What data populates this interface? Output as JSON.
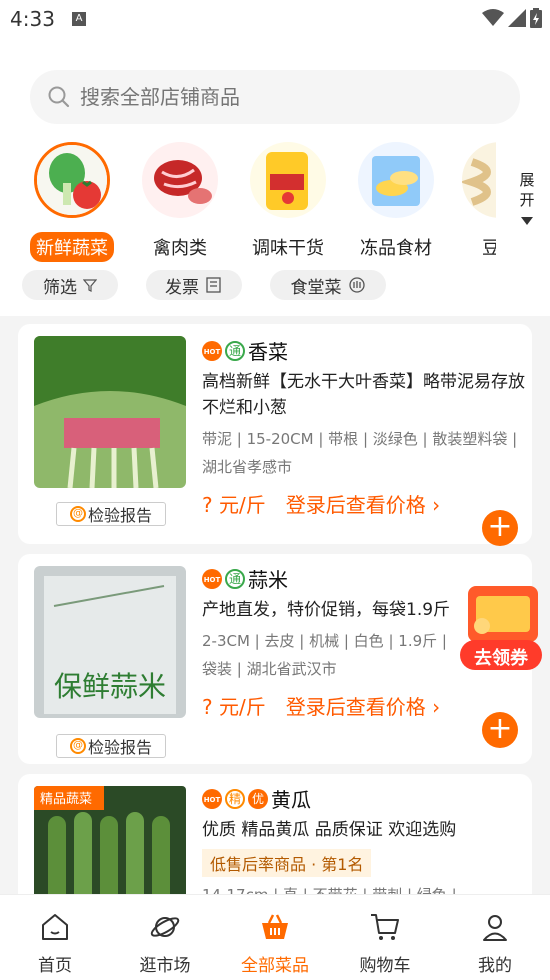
{
  "status": {
    "time": "4:33",
    "sim": "A"
  },
  "search": {
    "placeholder": "搜索全部店铺商品"
  },
  "categories": [
    {
      "label": "新鲜蔬菜",
      "active": true
    },
    {
      "label": "禽肉类"
    },
    {
      "label": "调味干货"
    },
    {
      "label": "冻品食材"
    },
    {
      "label": "豆"
    }
  ],
  "expand_label": "展开",
  "filters": [
    {
      "label": "筛选",
      "icon": "filter-icon"
    },
    {
      "label": "发票",
      "icon": "invoice-icon"
    },
    {
      "label": "食堂菜",
      "icon": "canteen-icon"
    }
  ],
  "products": [
    {
      "name": "香菜",
      "badges": [
        "HOT",
        "通"
      ],
      "desc": "高档新鲜【无水干大叶香菜】略带泥易存放不烂和小葱",
      "spec": "带泥 | 15-20CM | 带根 | 淡绿色 | 散装塑料袋 | 湖北省孝感市",
      "price": "? 元/斤",
      "login_price": "登录后查看价格 ›",
      "report": "检验报告"
    },
    {
      "name": "蒜米",
      "badges": [
        "HOT",
        "通"
      ],
      "desc": "产地直发，特价促销，每袋1.9斤",
      "spec": "2-3CM | 去皮 | 机械 | 白色 | 1.9斤 | 袋装 | 湖北省武汉市",
      "price": "? 元/斤",
      "login_price": "登录后查看价格 ›",
      "report": "检验报告"
    },
    {
      "name": "黄瓜",
      "badges": [
        "HOT",
        "精",
        "优"
      ],
      "tag": "精品蔬菜",
      "desc": "优质 精品黄瓜 品质保证 欢迎选购",
      "rank": "低售后率商品 · 第1名",
      "spec": "14-17cm | 直 | 不带花 | 带刺 | 绿色 |"
    }
  ],
  "coupon": {
    "label": "去领券"
  },
  "tabs": [
    {
      "label": "首页",
      "icon": "home-icon"
    },
    {
      "label": "逛市场",
      "icon": "planet-icon"
    },
    {
      "label": "全部菜品",
      "icon": "basket-icon",
      "active": true
    },
    {
      "label": "购物车",
      "icon": "cart-icon"
    },
    {
      "label": "我的",
      "icon": "user-icon"
    }
  ],
  "colors": {
    "accent": "#ff6a00",
    "price": "#ff5a00",
    "green": "#3aa84b"
  }
}
